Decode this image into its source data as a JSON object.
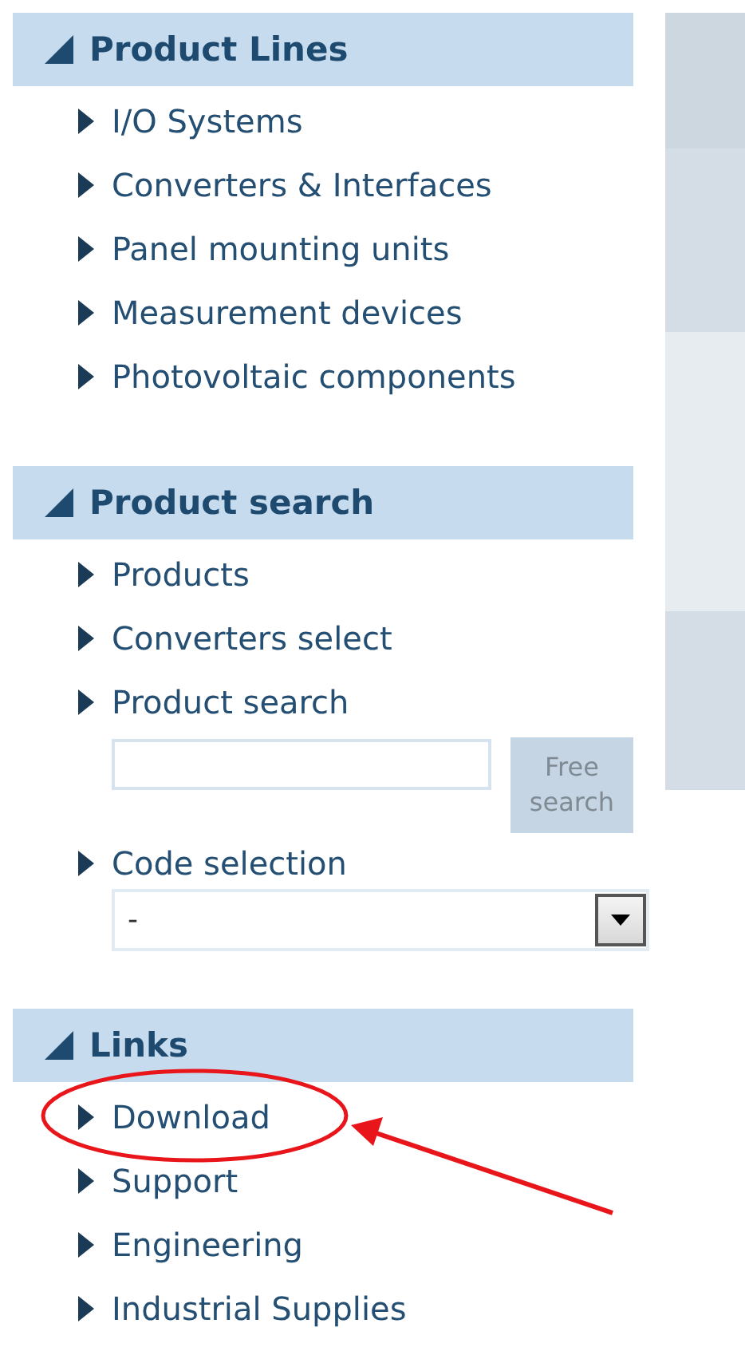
{
  "sections": [
    {
      "title": "Product Lines",
      "expanded": true,
      "items": [
        {
          "kind": "link",
          "label": "I/O Systems"
        },
        {
          "kind": "link",
          "label": "Converters & Interfaces"
        },
        {
          "kind": "link",
          "label": "Panel mounting units"
        },
        {
          "kind": "link",
          "label": "Measurement devices"
        },
        {
          "kind": "link",
          "label": "Photovoltaic components"
        }
      ]
    },
    {
      "title": "Product search",
      "expanded": true,
      "items": [
        {
          "kind": "link",
          "label": "Products"
        },
        {
          "kind": "link",
          "label": "Converters select"
        },
        {
          "kind": "link",
          "label": "Product search"
        },
        {
          "kind": "search",
          "button": "Free search"
        },
        {
          "kind": "select",
          "label": "Code selection",
          "value": "-"
        }
      ]
    },
    {
      "title": "Links",
      "expanded": true,
      "items": [
        {
          "kind": "link",
          "label": "Download",
          "circled": true
        },
        {
          "kind": "link",
          "label": "Support",
          "circled": false
        },
        {
          "kind": "link",
          "label": "Engineering",
          "circled": false
        },
        {
          "kind": "link",
          "label": "Industrial Supplies",
          "circled": false
        }
      ]
    }
  ]
}
